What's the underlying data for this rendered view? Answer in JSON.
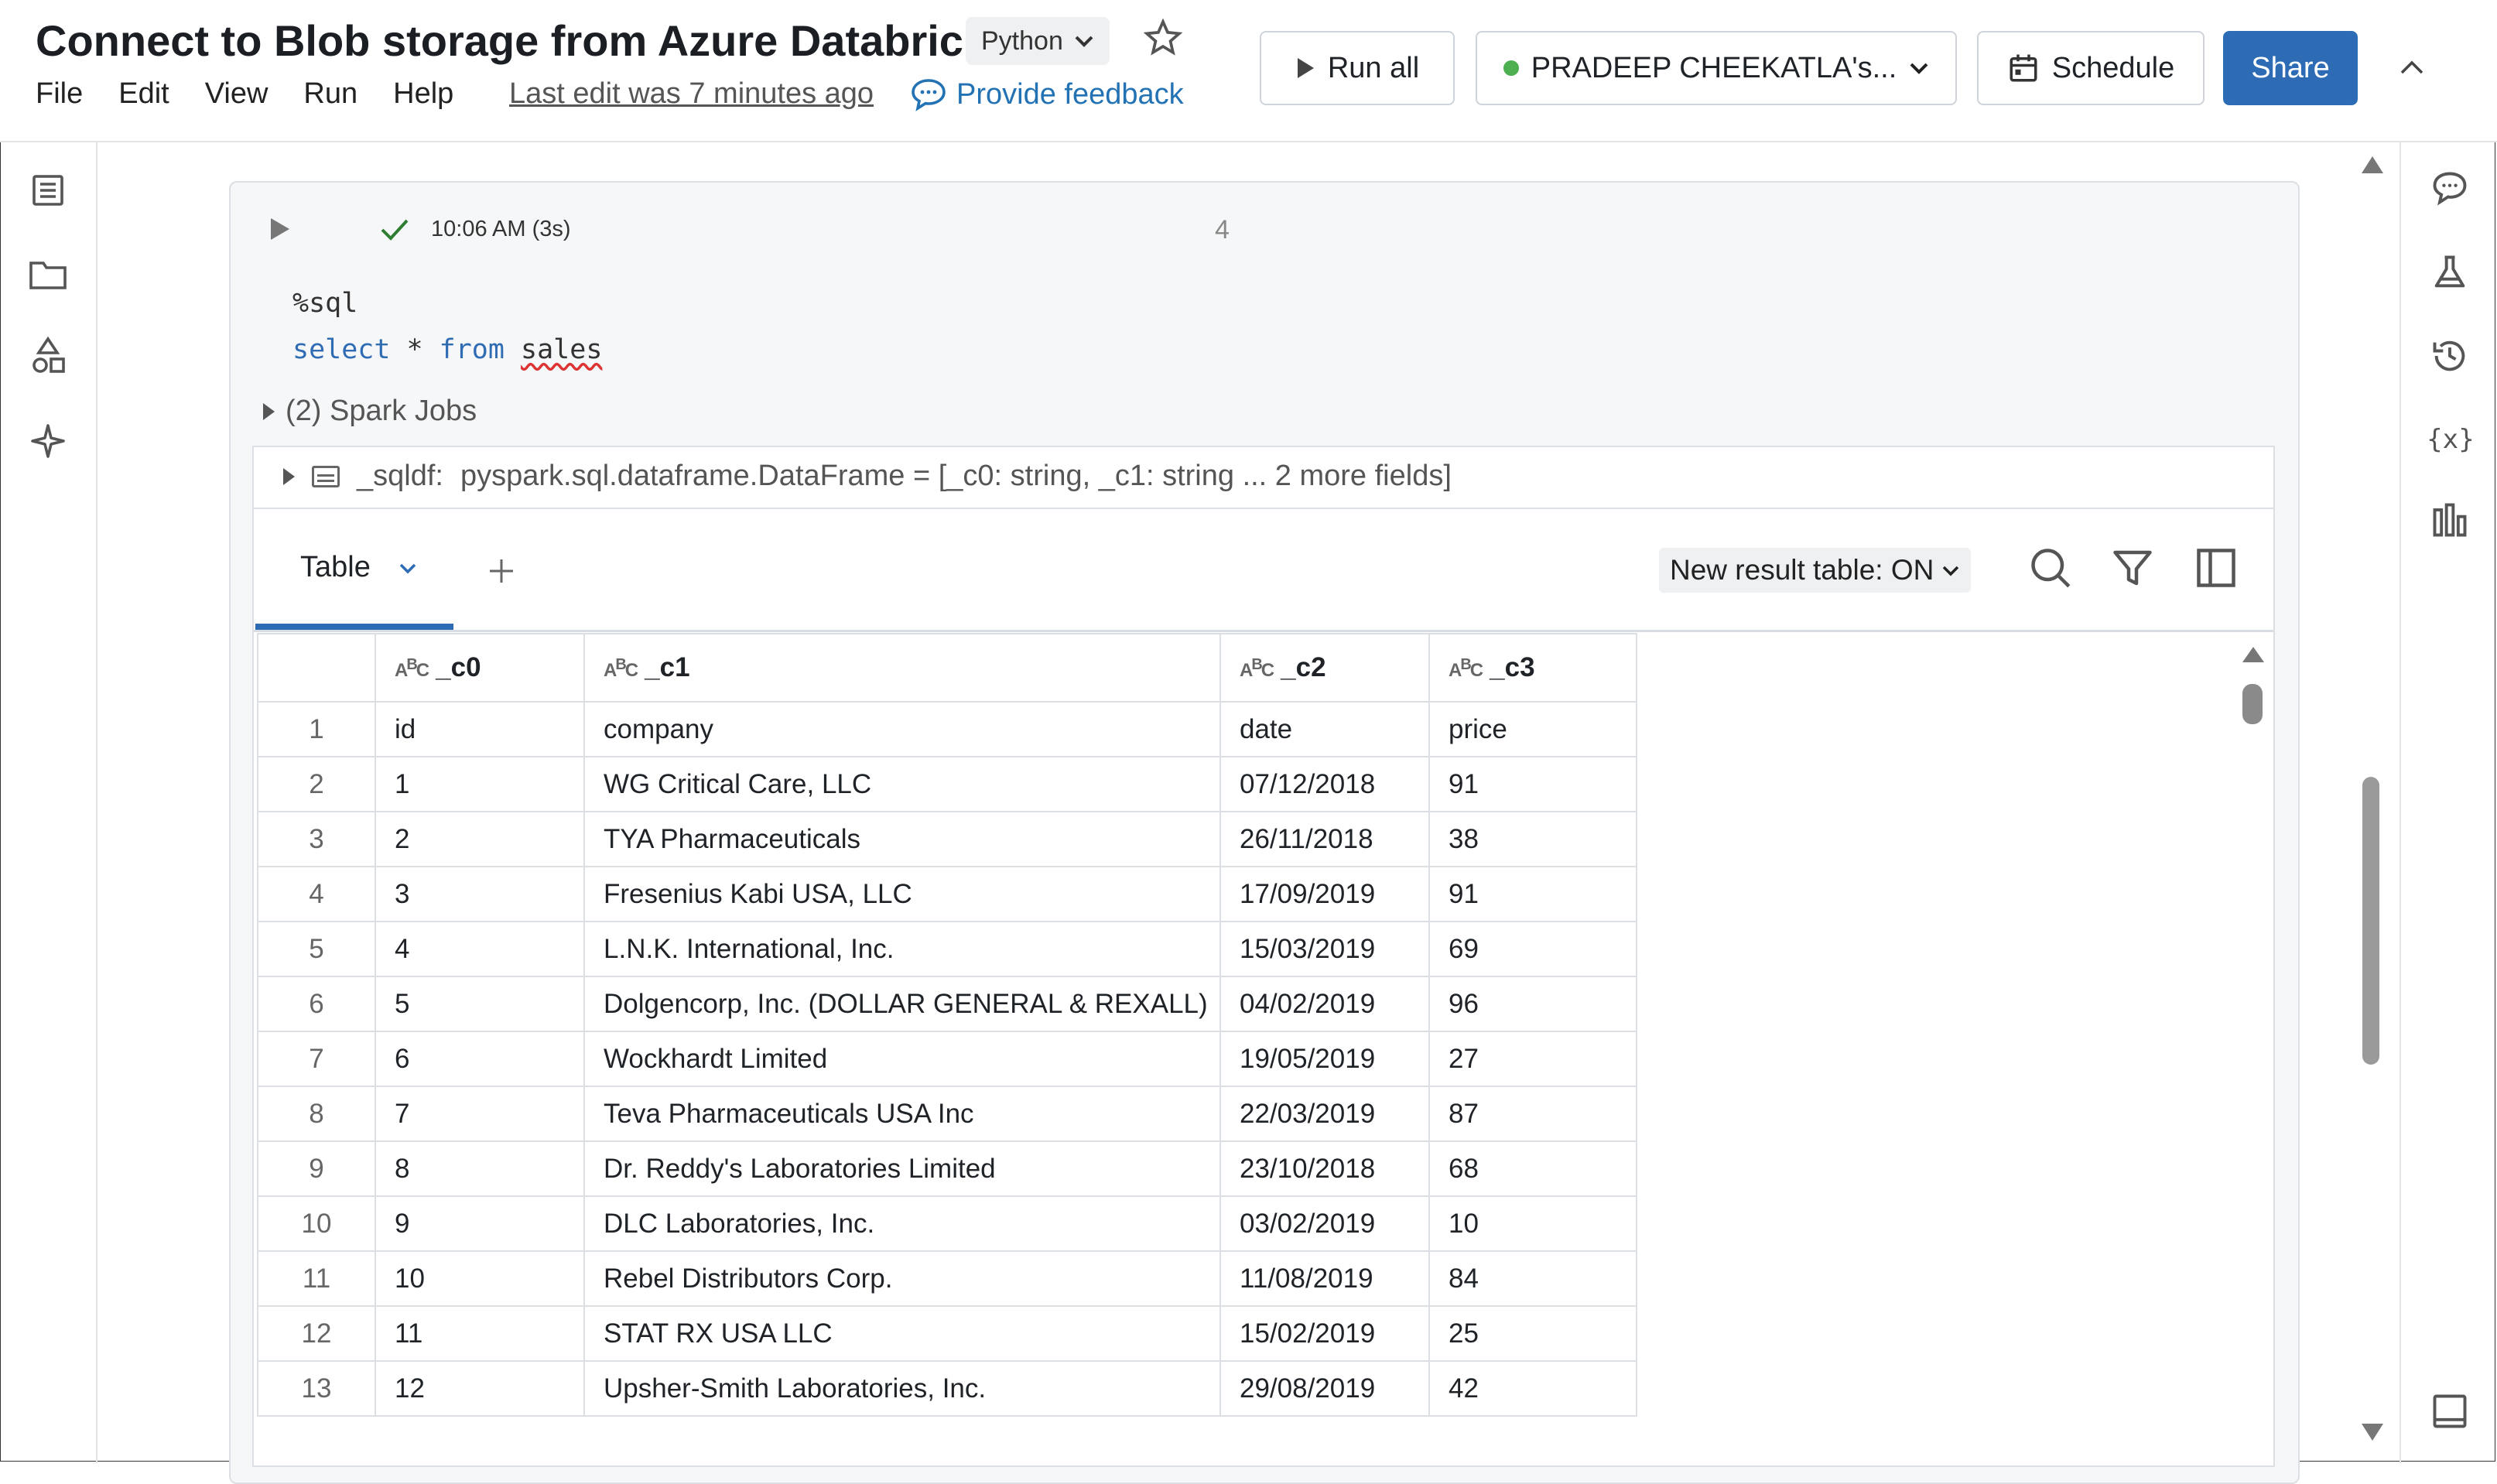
{
  "header": {
    "title": "Connect to Blob storage from Azure Databric...",
    "language": "Python",
    "menu": [
      "File",
      "Edit",
      "View",
      "Run",
      "Help"
    ],
    "last_edit": "Last edit was 7 minutes ago",
    "feedback": "Provide feedback",
    "run_all": "Run all",
    "cluster": "PRADEEP CHEEKATLA's...",
    "schedule": "Schedule",
    "share": "Share"
  },
  "cell": {
    "status_time": "10:06 AM (3s)",
    "count": "4",
    "code_line1": "%sql",
    "code_kw1": "select",
    "code_mid": " * ",
    "code_kw2": "from",
    "code_table": "sales",
    "spark_jobs": "(2) Spark Jobs",
    "df_name": "_sqldf:",
    "df_type": "pyspark.sql.dataframe.DataFrame = [_c0: string, _c1: string ... 2 more fields]"
  },
  "results": {
    "tab_label": "Table",
    "new_result_label": "New result table: ON",
    "columns": [
      "_c0",
      "_c1",
      "_c2",
      "_c3"
    ],
    "rows": [
      [
        "1",
        "id",
        "company",
        "date",
        "price"
      ],
      [
        "2",
        "1",
        "WG Critical Care, LLC",
        "07/12/2018",
        "91"
      ],
      [
        "3",
        "2",
        "TYA Pharmaceuticals",
        "26/11/2018",
        "38"
      ],
      [
        "4",
        "3",
        "Fresenius Kabi USA, LLC",
        "17/09/2019",
        "91"
      ],
      [
        "5",
        "4",
        "L.N.K. International, Inc.",
        "15/03/2019",
        "69"
      ],
      [
        "6",
        "5",
        "Dolgencorp, Inc. (DOLLAR GENERAL & REXALL)",
        "04/02/2019",
        "96"
      ],
      [
        "7",
        "6",
        "Wockhardt Limited",
        "19/05/2019",
        "27"
      ],
      [
        "8",
        "7",
        "Teva Pharmaceuticals USA Inc",
        "22/03/2019",
        "87"
      ],
      [
        "9",
        "8",
        "Dr. Reddy's Laboratories Limited",
        "23/10/2018",
        "68"
      ],
      [
        "10",
        "9",
        "DLC Laboratories, Inc.",
        "03/02/2019",
        "10"
      ],
      [
        "11",
        "10",
        "Rebel Distributors Corp.",
        "11/08/2019",
        "84"
      ],
      [
        "12",
        "11",
        "STAT RX USA LLC",
        "15/02/2019",
        "25"
      ],
      [
        "13",
        "12",
        "Upsher-Smith Laboratories, Inc.",
        "29/08/2019",
        "42"
      ]
    ]
  },
  "icons": {
    "left_rail": [
      "table-of-contents-icon",
      "folder-icon",
      "shapes-icon",
      "sparkle-icon"
    ],
    "right_rail": [
      "comment-icon",
      "experiment-icon",
      "history-icon",
      "variables-icon",
      "chart-icon",
      "panel-icon"
    ]
  },
  "colors": {
    "accent": "#2d6cb5",
    "status_dot": "#4caf50",
    "success": "#2e7d32"
  }
}
